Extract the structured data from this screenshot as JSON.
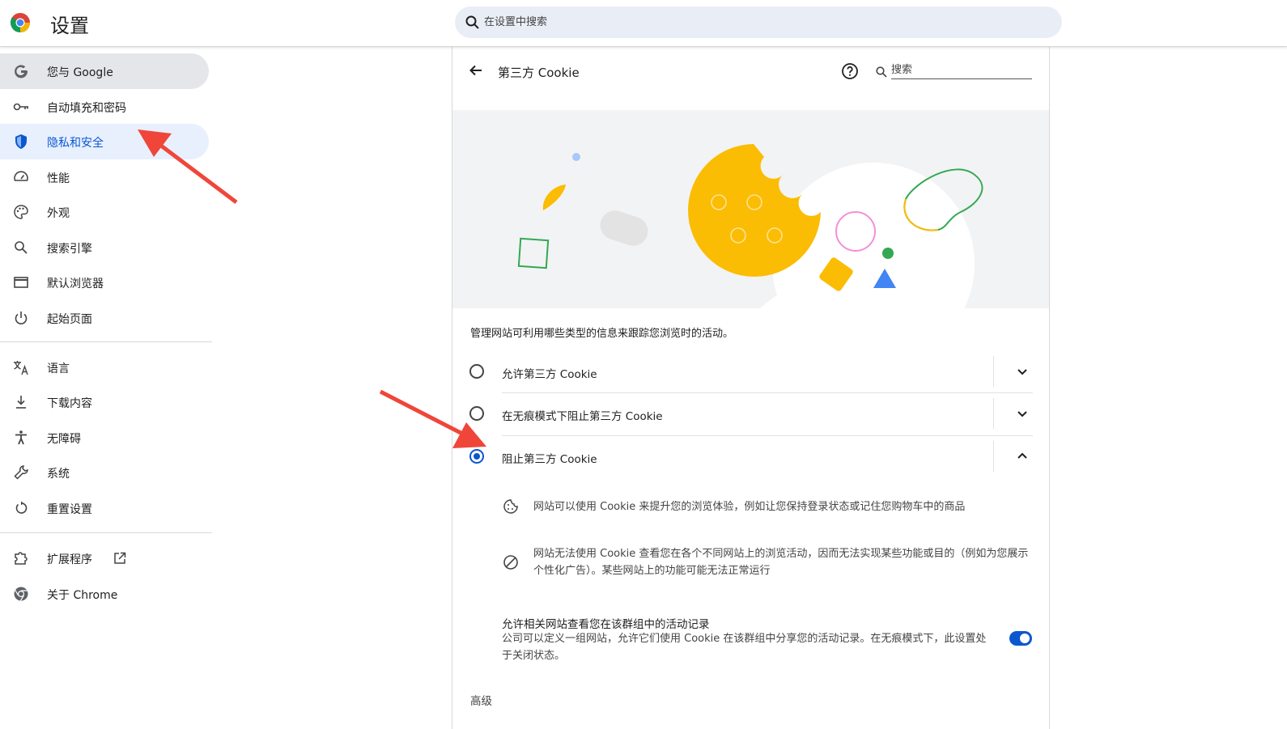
{
  "header": {
    "title": "设置",
    "search_placeholder": "在设置中搜索",
    "logo": "chrome-logo"
  },
  "sidebar": {
    "items": [
      {
        "label": "您与 Google",
        "icon": "google-g-icon"
      },
      {
        "label": "自动填充和密码",
        "icon": "key-icon"
      },
      {
        "label": "隐私和安全",
        "icon": "shield-icon"
      },
      {
        "label": "性能",
        "icon": "speedometer-icon"
      },
      {
        "label": "外观",
        "icon": "palette-icon"
      },
      {
        "label": "搜索引擎",
        "icon": "search-icon"
      },
      {
        "label": "默认浏览器",
        "icon": "browser-window-icon"
      },
      {
        "label": "起始页面",
        "icon": "power-icon"
      },
      {
        "label": "语言",
        "icon": "translate-icon"
      },
      {
        "label": "下载内容",
        "icon": "download-icon"
      },
      {
        "label": "无障碍",
        "icon": "accessibility-icon"
      },
      {
        "label": "系统",
        "icon": "wrench-icon"
      },
      {
        "label": "重置设置",
        "icon": "reset-icon"
      },
      {
        "label": "扩展程序",
        "icon": "extension-icon"
      },
      {
        "label": "关于 Chrome",
        "icon": "chrome-icon"
      }
    ],
    "active_index": 2
  },
  "page": {
    "title": "第三方 Cookie",
    "search_placeholder": "搜索",
    "description": "管理网站可利用哪些类型的信息来跟踪您浏览时的活动。",
    "options": [
      {
        "label": "允许第三方 Cookie",
        "selected": false
      },
      {
        "label": "在无痕模式下阻止第三方 Cookie",
        "selected": false
      },
      {
        "label": "阻止第三方 Cookie",
        "selected": true
      }
    ],
    "details": [
      {
        "icon": "cookie-icon",
        "text": "网站可以使用 Cookie 来提升您的浏览体验，例如让您保持登录状态或记住您购物车中的商品"
      },
      {
        "icon": "block-icon",
        "text": "网站无法使用 Cookie 查看您在各个不同网站上的浏览活动，因而无法实现某些功能或目的（例如为您展示个性化广告）。某些网站上的功能可能无法正常运行"
      }
    ],
    "related_sites": {
      "title": "允许相关网站查看您在该群组中的活动记录",
      "description": "公司可以定义一组网站，允许它们使用 Cookie 在该群组中分享您的活动记录。在无痕模式下，此设置处于关闭状态。",
      "enabled": true
    },
    "advanced_label": "高级"
  },
  "colors": {
    "accent": "#0b57d0",
    "active_bg": "#e8f0fe",
    "arrow": "#f0463a"
  }
}
